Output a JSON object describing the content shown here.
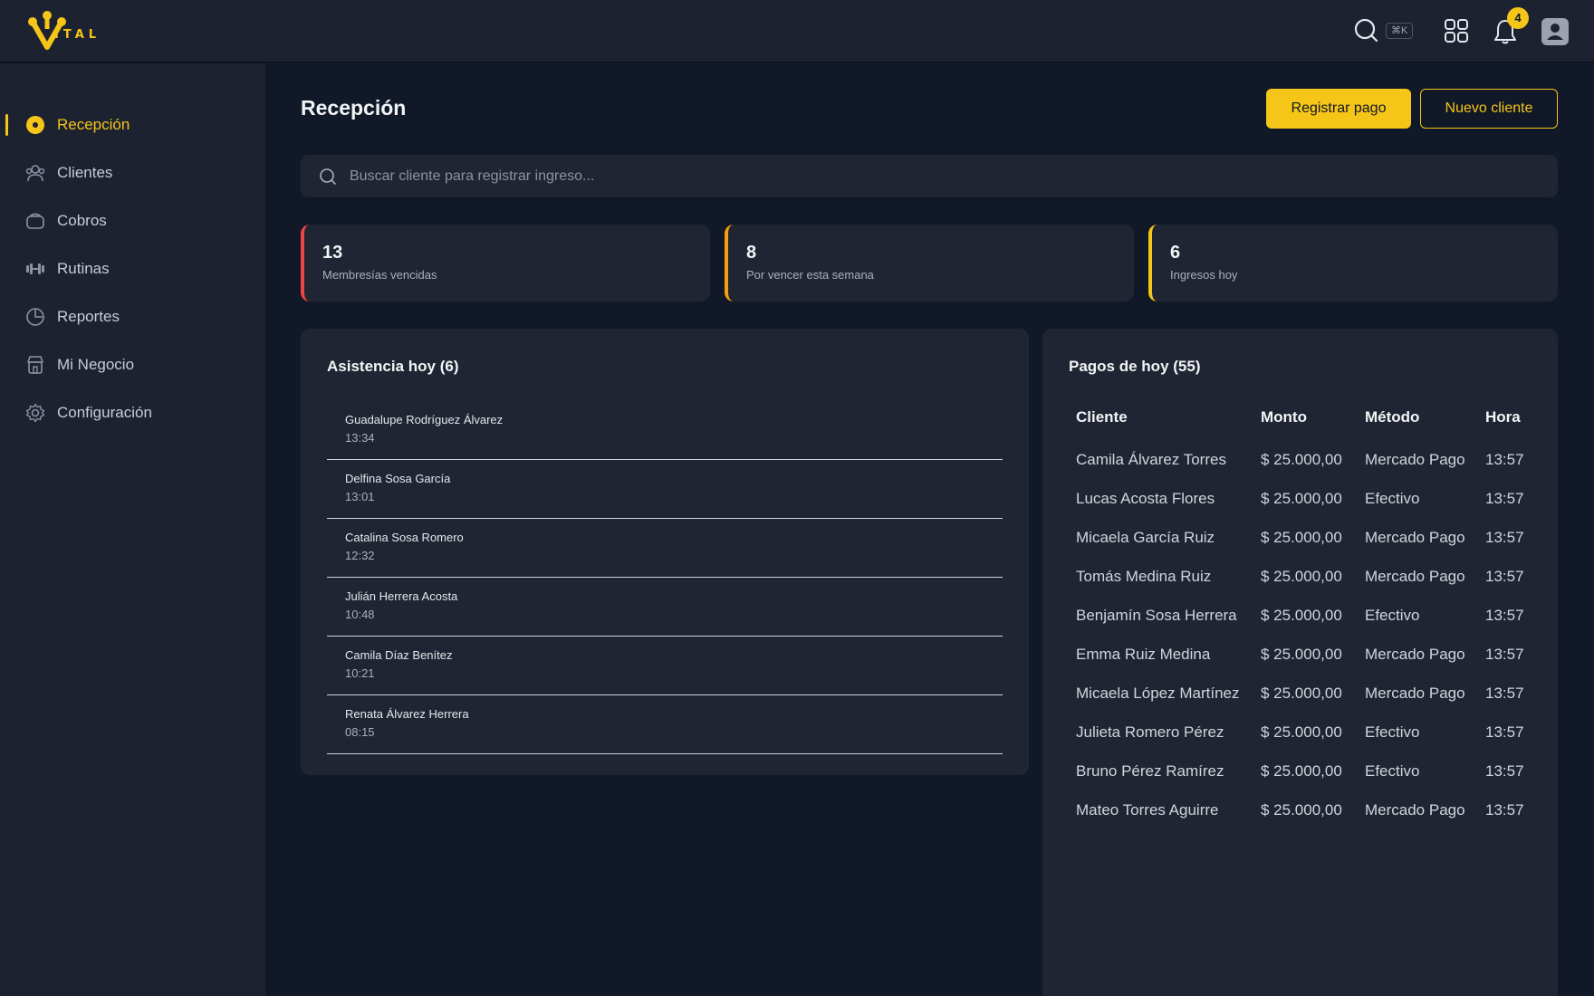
{
  "app": {
    "logo_text": "ITAL",
    "brand_color": "#f5c518"
  },
  "header": {
    "search_icon": "search-icon",
    "shortcut": "⌘K",
    "apps_icon": "grid-icon",
    "notifications_icon": "bell-icon",
    "notifications_count": "4",
    "avatar_icon": "user-icon"
  },
  "sidebar": {
    "items": [
      {
        "label": "Recepción",
        "icon": "reception-icon",
        "active": true
      },
      {
        "label": "Clientes",
        "icon": "users-icon",
        "active": false
      },
      {
        "label": "Cobros",
        "icon": "wallet-icon",
        "active": false
      },
      {
        "label": "Rutinas",
        "icon": "dumbbell-icon",
        "active": false
      },
      {
        "label": "Reportes",
        "icon": "pie-chart-icon",
        "active": false
      },
      {
        "label": "Mi Negocio",
        "icon": "store-icon",
        "active": false
      },
      {
        "label": "Configuración",
        "icon": "gear-icon",
        "active": false
      }
    ]
  },
  "main": {
    "title": "Recepción",
    "actions": {
      "primary": "Registrar pago",
      "secondary": "Nuevo cliente"
    },
    "search": {
      "placeholder": "Buscar cliente para registrar ingreso...",
      "value": ""
    },
    "stats": [
      {
        "value": "13",
        "label": "Membresías vencidas",
        "accent": "#ef4444"
      },
      {
        "value": "8",
        "label": "Por vencer esta semana",
        "accent": "#f59e0b"
      },
      {
        "value": "6",
        "label": "Ingresos hoy",
        "accent": "#f5c518"
      }
    ],
    "attendance": {
      "title": "Asistencia hoy (6)",
      "rows": [
        {
          "name": "Guadalupe Rodríguez Álvarez",
          "time": "13:34"
        },
        {
          "name": "Delfina Sosa García",
          "time": "13:01"
        },
        {
          "name": "Catalina Sosa Romero",
          "time": "12:32"
        },
        {
          "name": "Julián Herrera Acosta",
          "time": "10:48"
        },
        {
          "name": "Camila Díaz Benítez",
          "time": "10:21"
        },
        {
          "name": "Renata Álvarez Herrera",
          "time": "08:15"
        }
      ]
    },
    "payments": {
      "title": "Pagos de hoy (55)",
      "columns": [
        "Cliente",
        "Monto",
        "Método",
        "Hora"
      ],
      "rows": [
        [
          "Camila Álvarez Torres",
          "$ 25.000,00",
          "Mercado Pago",
          "13:57"
        ],
        [
          "Lucas Acosta Flores",
          "$ 25.000,00",
          "Efectivo",
          "13:57"
        ],
        [
          "Micaela García Ruiz",
          "$ 25.000,00",
          "Mercado Pago",
          "13:57"
        ],
        [
          "Tomás Medina Ruiz",
          "$ 25.000,00",
          "Mercado Pago",
          "13:57"
        ],
        [
          "Benjamín Sosa Herrera",
          "$ 25.000,00",
          "Efectivo",
          "13:57"
        ],
        [
          "Emma Ruiz Medina",
          "$ 25.000,00",
          "Mercado Pago",
          "13:57"
        ],
        [
          "Micaela López Martínez",
          "$ 25.000,00",
          "Mercado Pago",
          "13:57"
        ],
        [
          "Julieta Romero Pérez",
          "$ 25.000,00",
          "Efectivo",
          "13:57"
        ],
        [
          "Bruno Pérez Ramírez",
          "$ 25.000,00",
          "Efectivo",
          "13:57"
        ],
        [
          "Mateo Torres Aguirre",
          "$ 25.000,00",
          "Mercado Pago",
          "13:57"
        ]
      ]
    }
  }
}
